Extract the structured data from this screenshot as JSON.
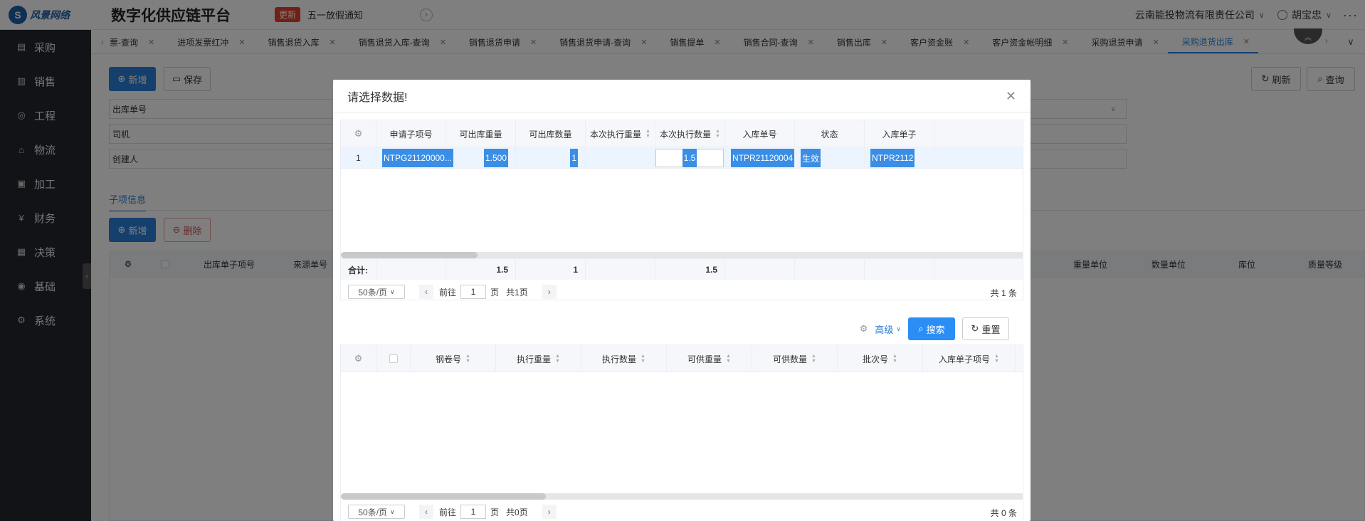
{
  "header": {
    "logo_text": "风景网络",
    "app_title": "数字化供应链平台",
    "update_tag": "更新",
    "notice": "五一放假通知",
    "company": "云南能投物流有限责任公司",
    "user": "胡宝忠"
  },
  "sidebar": {
    "items": [
      {
        "label": "采购",
        "icon": "purchase-icon"
      },
      {
        "label": "销售",
        "icon": "sales-icon"
      },
      {
        "label": "工程",
        "icon": "engineering-icon"
      },
      {
        "label": "物流",
        "icon": "logistics-icon"
      },
      {
        "label": "加工",
        "icon": "processing-icon"
      },
      {
        "label": "财务",
        "icon": "finance-icon"
      },
      {
        "label": "决策",
        "icon": "decision-icon"
      },
      {
        "label": "基础",
        "icon": "base-icon"
      },
      {
        "label": "系统",
        "icon": "system-icon"
      }
    ]
  },
  "tabs": [
    {
      "label": "票-查询"
    },
    {
      "label": "进项发票红冲"
    },
    {
      "label": "销售退货入库"
    },
    {
      "label": "销售退货入库-查询"
    },
    {
      "label": "销售退货申请"
    },
    {
      "label": "销售退货申请-查询"
    },
    {
      "label": "销售提单"
    },
    {
      "label": "销售合同-查询"
    },
    {
      "label": "销售出库"
    },
    {
      "label": "客户资金账"
    },
    {
      "label": "客户资金帐明细"
    },
    {
      "label": "采购退货申请"
    },
    {
      "label": "采购退货出库",
      "active": true
    }
  ],
  "toolbar": {
    "add": "新增",
    "save": "保存",
    "refresh": "刷新",
    "query": "查询"
  },
  "form": {
    "outbound_no": "出库单号",
    "driver": "司机",
    "creator": "创建人"
  },
  "sub_section": {
    "tab": "子项信息",
    "add": "新增",
    "delete": "删除",
    "columns": [
      "出库单子项号",
      "来源单号",
      "重量单位",
      "数量单位",
      "库位",
      "质量等级"
    ]
  },
  "modal": {
    "title": "请选择数据!",
    "table1": {
      "columns": [
        "申请子项号",
        "可出库重量",
        "可出库数量",
        "本次执行重量",
        "本次执行数量",
        "入库单号",
        "状态",
        "入库单子"
      ],
      "rows": [
        {
          "index": "1",
          "apply_sub_no": "NTPG21120000...",
          "avail_weight": "1.500",
          "avail_qty": "1",
          "exec_weight": "",
          "exec_qty": "1.5",
          "inbound_no": "NTPR21120004",
          "status": "生效",
          "inbound_sub": "NTPR2112"
        }
      ],
      "summary": {
        "label": "合计:",
        "avail_weight": "1.5",
        "avail_qty": "1",
        "exec_qty": "1.5"
      },
      "pager": {
        "size": "50条/页",
        "goto": "前往",
        "page": "1",
        "page_unit": "页",
        "total_pages": "共1页",
        "total": "共 1 条"
      }
    },
    "search_bar": {
      "advanced": "高级",
      "search": "搜索",
      "reset": "重置"
    },
    "table2": {
      "columns": [
        "钢卷号",
        "执行重量",
        "执行数量",
        "可供重量",
        "可供数量",
        "批次号",
        "入库单子项号"
      ],
      "pager": {
        "size": "50条/页",
        "goto": "前往",
        "page": "1",
        "page_unit": "页",
        "total_pages": "共0页",
        "total": "共 0 条"
      }
    }
  }
}
